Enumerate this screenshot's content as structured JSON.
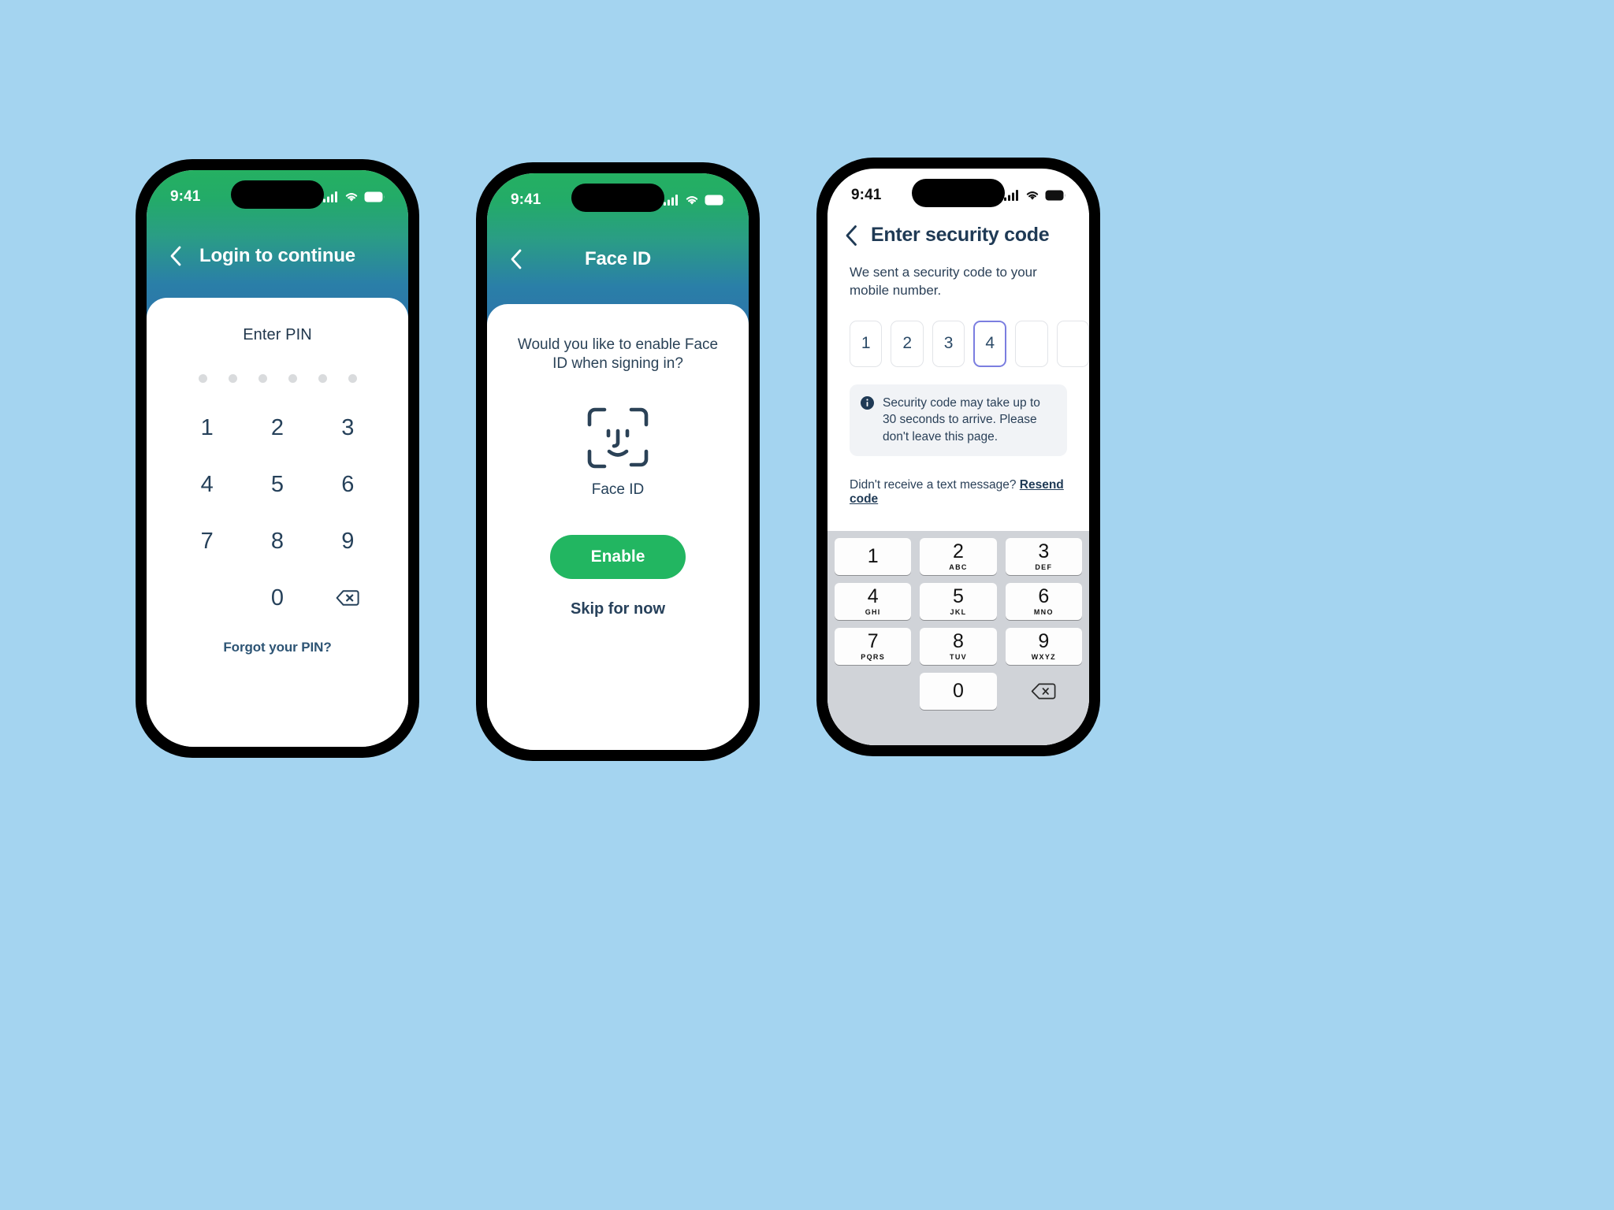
{
  "canvas": {
    "background": "#a4d4f0"
  },
  "theme": {
    "green": "#22b661",
    "gradient_top": "#25b062",
    "gradient_bottom": "#2d72aa",
    "navy": "#1f3a55",
    "focus_purple": "#7b7ee0",
    "keyboard_bg": "#d0d3d8"
  },
  "phone1": {
    "status": {
      "time": "9:41",
      "cellular_icon": "cellular-bars-icon",
      "wifi_icon": "wifi-icon",
      "battery_icon": "battery-icon"
    },
    "nav": {
      "back_icon": "chevron-left-icon",
      "title": "Login to continue"
    },
    "pin": {
      "label": "Enter PIN",
      "dot_count": 6,
      "keys": [
        "1",
        "2",
        "3",
        "4",
        "5",
        "6",
        "7",
        "8",
        "9",
        "",
        "0",
        "backspace"
      ],
      "backspace_icon": "backspace-icon",
      "forgot_label": "Forgot your PIN?"
    }
  },
  "phone2": {
    "status": {
      "time": "9:41",
      "cellular_icon": "cellular-bars-icon",
      "wifi_icon": "wifi-icon",
      "battery_icon": "battery-icon"
    },
    "nav": {
      "back_icon": "chevron-left-icon",
      "title": "Face ID"
    },
    "faceid": {
      "question": "Would you like to enable Face ID when signing in?",
      "icon": "face-id-icon",
      "caption": "Face ID",
      "enable_label": "Enable",
      "skip_label": "Skip for now"
    }
  },
  "phone3": {
    "status": {
      "time": "9:41",
      "cellular_icon": "cellular-bars-icon",
      "wifi_icon": "wifi-icon",
      "battery_icon": "battery-icon"
    },
    "nav": {
      "back_icon": "chevron-left-icon",
      "title": "Enter security code"
    },
    "subtitle": "We sent a security code to your mobile number.",
    "otp": {
      "values": [
        "1",
        "2",
        "3",
        "4",
        "",
        ""
      ],
      "focused_index": 3,
      "length": 6
    },
    "info": {
      "icon": "info-circle-icon",
      "text": "Security code may take up to 30 seconds to arrive. Please don't leave this page."
    },
    "resend": {
      "prompt": "Didn't receive a text message?",
      "link_label": "Resend code"
    },
    "keyboard": {
      "keys": [
        {
          "num": "1",
          "letters": ""
        },
        {
          "num": "2",
          "letters": "ABC"
        },
        {
          "num": "3",
          "letters": "DEF"
        },
        {
          "num": "4",
          "letters": "GHI"
        },
        {
          "num": "5",
          "letters": "JKL"
        },
        {
          "num": "6",
          "letters": "MNO"
        },
        {
          "num": "7",
          "letters": "PQRS"
        },
        {
          "num": "8",
          "letters": "TUV"
        },
        {
          "num": "9",
          "letters": "WXYZ"
        },
        {
          "num": "0",
          "letters": ""
        }
      ],
      "delete_icon": "backspace-icon"
    }
  }
}
